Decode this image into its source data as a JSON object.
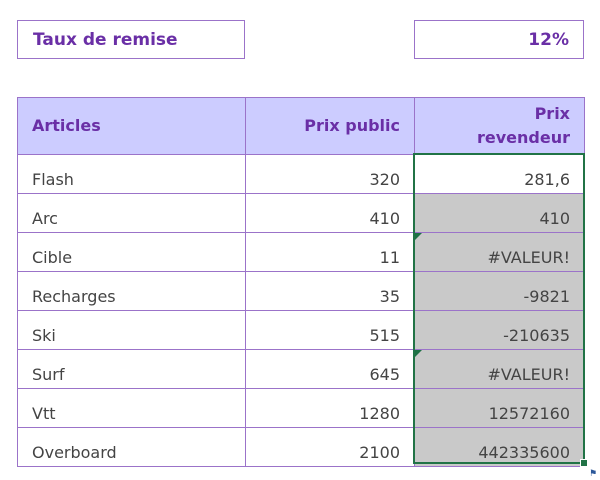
{
  "rate": {
    "label": "Taux de remise",
    "value": "12%"
  },
  "table": {
    "headers": {
      "articles": "Articles",
      "public_price": "Prix public",
      "reseller_price_line1": "Prix",
      "reseller_price_line2": "revendeur"
    },
    "rows": [
      {
        "article": "Flash",
        "public_price": "320",
        "reseller_price": "281,6"
      },
      {
        "article": "Arc",
        "public_price": "410",
        "reseller_price": "410"
      },
      {
        "article": "Cible",
        "public_price": "11",
        "reseller_price": "#VALEUR!"
      },
      {
        "article": "Recharges",
        "public_price": "35",
        "reseller_price": "-9821"
      },
      {
        "article": "Ski",
        "public_price": "515",
        "reseller_price": "-210635"
      },
      {
        "article": "Surf",
        "public_price": "645",
        "reseller_price": "#VALEUR!"
      },
      {
        "article": "Vtt",
        "public_price": "1280",
        "reseller_price": "12572160"
      },
      {
        "article": "Overboard",
        "public_price": "2100",
        "reseller_price": "442335600"
      }
    ]
  },
  "colors": {
    "accent_text": "#6a2fa6",
    "border": "#9b73c9",
    "header_fill": "#ccccff",
    "selection_fill": "#c9c9c9",
    "selection_border": "#217346"
  },
  "icons": {
    "error_indicator": "green-triangle-icon",
    "fill_handle": "fill-handle-icon",
    "quick_analysis": "quick-analysis-icon"
  }
}
